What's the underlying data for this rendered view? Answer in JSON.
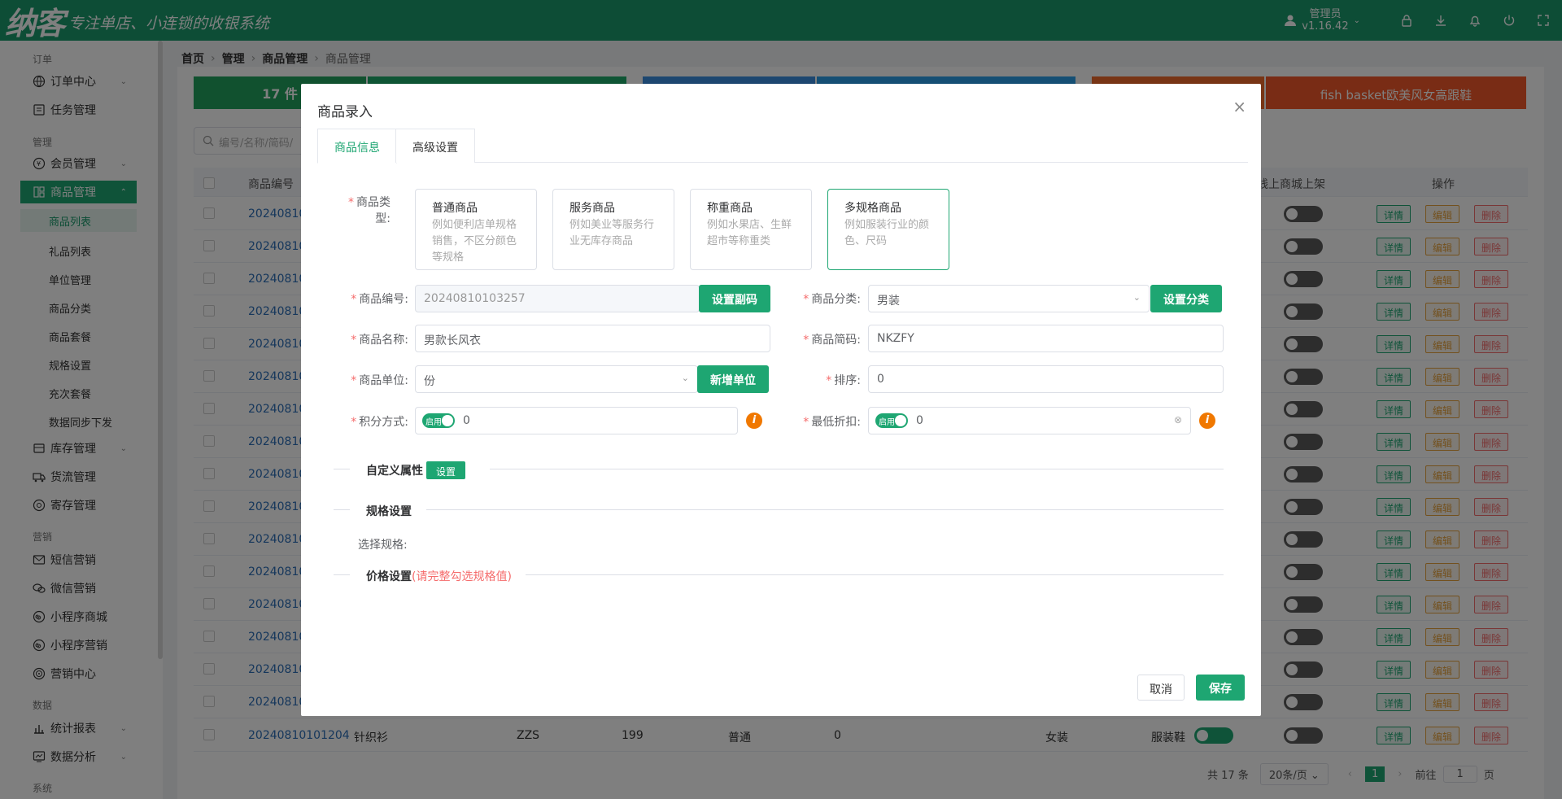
{
  "app": {
    "logo": "纳客",
    "slogan": "专注单店、小连锁的收银系统",
    "user_name": "管理员",
    "version": "v1.16.42",
    "accent": "#1a9b6c"
  },
  "sidebar": {
    "sections": {
      "order": "订单",
      "manage": "管理",
      "marketing": "营销",
      "data": "数据",
      "system": "系统"
    },
    "items": {
      "order_center": "订单中心",
      "task": "任务管理",
      "member": "会员管理",
      "goods": "商品管理",
      "stock": "库存管理",
      "logistics": "货流管理",
      "deposit": "寄存管理",
      "sms": "短信营销",
      "wechat": "微信营销",
      "mini_mall": "小程序商城",
      "mini_mkt": "小程序营销",
      "mkt_center": "营销中心",
      "report": "统计报表",
      "analysis": "数据分析"
    },
    "sub": {
      "list": "商品列表",
      "gift": "礼品列表",
      "unit": "单位管理",
      "category": "商品分类",
      "package": "商品套餐",
      "spec": "规格设置",
      "recharge": "充次套餐",
      "sync": "数据同步下发"
    }
  },
  "breadcrumb": {
    "home": "首页",
    "manage": "管理",
    "goods": "商品管理",
    "current": "商品管理"
  },
  "background": {
    "stat1": "17 件",
    "stat2": "fish basket欧美风女高跟鞋",
    "search_placeholder": "编号/名称/简码/",
    "col_code": "商品编号",
    "col_online": "线上商城上架",
    "col_ops": "操作",
    "row_code_prefix": "202408101",
    "last_row": {
      "code": "20240810101204",
      "name": "针织衫",
      "short": "ZZS",
      "price": "199",
      "type": "普通",
      "points": "0",
      "cat": "女装",
      "cat2": "服装鞋"
    },
    "btn_detail": "详情",
    "btn_edit": "编辑",
    "btn_delete": "删除",
    "pager": {
      "total": "共 17 条",
      "size": "20条/页",
      "page": "1",
      "goto": "前往",
      "goto_val": "1",
      "page_suffix": "页"
    }
  },
  "modal": {
    "title": "商品录入",
    "tabs": {
      "info": "商品信息",
      "advanced": "高级设置"
    },
    "type_label": "商品类型:",
    "types": [
      {
        "title": "普通商品",
        "desc": "例如便利店单规格销售，不区分颜色等规格"
      },
      {
        "title": "服务商品",
        "desc": "例如美业等服务行业无库存商品"
      },
      {
        "title": "称重商品",
        "desc": "例如水果店、生鲜超市等称重类"
      },
      {
        "title": "多规格商品",
        "desc": "例如服装行业的颜色、尺码"
      }
    ],
    "code_label": "商品编号:",
    "code_value": "20240810103257",
    "set_barcode": "设置副码",
    "category_label": "商品分类:",
    "category_value": "男装",
    "set_category": "设置分类",
    "name_label": "商品名称:",
    "name_value": "男款长风衣",
    "short_label": "商品简码:",
    "short_value": "NKZFY",
    "unit_label": "商品单位:",
    "unit_value": "份",
    "add_unit": "新增单位",
    "sort_label": "排序:",
    "sort_value": "0",
    "points_label": "积分方式:",
    "points_switch": "启用",
    "points_value": "0",
    "discount_label": "最低折扣:",
    "discount_switch": "启用",
    "discount_value": "0",
    "custom_attr": "自定义属性",
    "custom_btn": "设置",
    "spec_title": "规格设置",
    "spec_select": "选择规格:",
    "price_title": "价格设置",
    "price_warn": "(请完整勾选规格值)",
    "cancel": "取消",
    "save": "保存"
  }
}
